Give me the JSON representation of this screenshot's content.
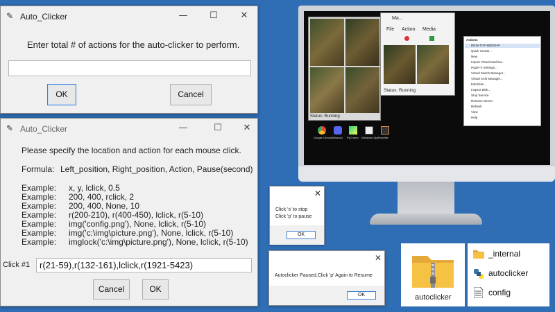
{
  "dialog_actions": {
    "title": "Auto_Clicker",
    "prompt": "Enter total # of actions for the auto-clicker to perform.",
    "input_value": "",
    "ok_label": "OK",
    "cancel_label": "Cancel"
  },
  "dialog_locations": {
    "title": "Auto_Clicker",
    "instruction": "Please specify the location and action for each mouse click.",
    "formula_label": "Formula:",
    "formula": "Left_position, Right_position, Action, Pause(second)",
    "examples": [
      {
        "label": "Example:",
        "value": "x, y, lclick, 0.5"
      },
      {
        "label": "Example:",
        "value": "200, 400, rclick, 2"
      },
      {
        "label": "Example:",
        "value": "200, 400, None, 10"
      },
      {
        "label": "Example:",
        "value": "r(200-210), r(400-450), lclick, r(5-10)"
      },
      {
        "label": "Example:",
        "value": "img('config.png'), None, lclick, r(5-10)"
      },
      {
        "label": "Example:",
        "value": "img('c:\\img\\picture.png'), None, lclick, r(5-10)"
      },
      {
        "label": "Example:",
        "value": "imglock('c:\\img\\picture.png'), None, lclick, r(5-10)"
      }
    ],
    "click_label": "Click #1",
    "click_value": "r(21-59),r(132-161),lclick,r(1921-5423)",
    "cancel_label": "Cancel",
    "ok_label": "OK"
  },
  "monitor": {
    "media_player": {
      "title": "Ma...",
      "menu": [
        "File",
        "Action",
        "Media"
      ],
      "status": "Status: Running"
    },
    "game_status": "Status: Running",
    "actions_panel": {
      "header": "Actions",
      "items": [
        "DESKTOP-8BDGHR",
        "Quick Create...",
        "New",
        "Import Virtual Machine...",
        "Hyper-V Settings...",
        "Virtual Switch Manager...",
        "Virtual SAN Manager...",
        "Edit Disk...",
        "Inspect Disk...",
        "Stop Service",
        "Remove Server",
        "Refresh",
        "View",
        "Help"
      ]
    },
    "taskbar_icons": [
      "Google Chrome",
      "Discord",
      "PyCharm",
      "Windows Spy",
      "Runelite"
    ]
  },
  "popup_hotkeys": {
    "line1": "Click 's' to stop",
    "line2": "Click 'p' to pause",
    "ok_label": "OK"
  },
  "popup_paused": {
    "message": "Autoclicker Paused,Click 'p' Again to Resume",
    "ok_label": "OK"
  },
  "zip_file": {
    "label": "autoclicker"
  },
  "file_list": [
    {
      "name": "_internal",
      "icon": "folder-icon"
    },
    {
      "name": "autoclicker",
      "icon": "python-exe-icon"
    },
    {
      "name": "config",
      "icon": "text-file-icon"
    }
  ],
  "colors": {
    "background": "#2f6db4",
    "window": "#f0f0f0",
    "accent": "#3c7fd6",
    "folder_yellow": "#f6c244"
  }
}
